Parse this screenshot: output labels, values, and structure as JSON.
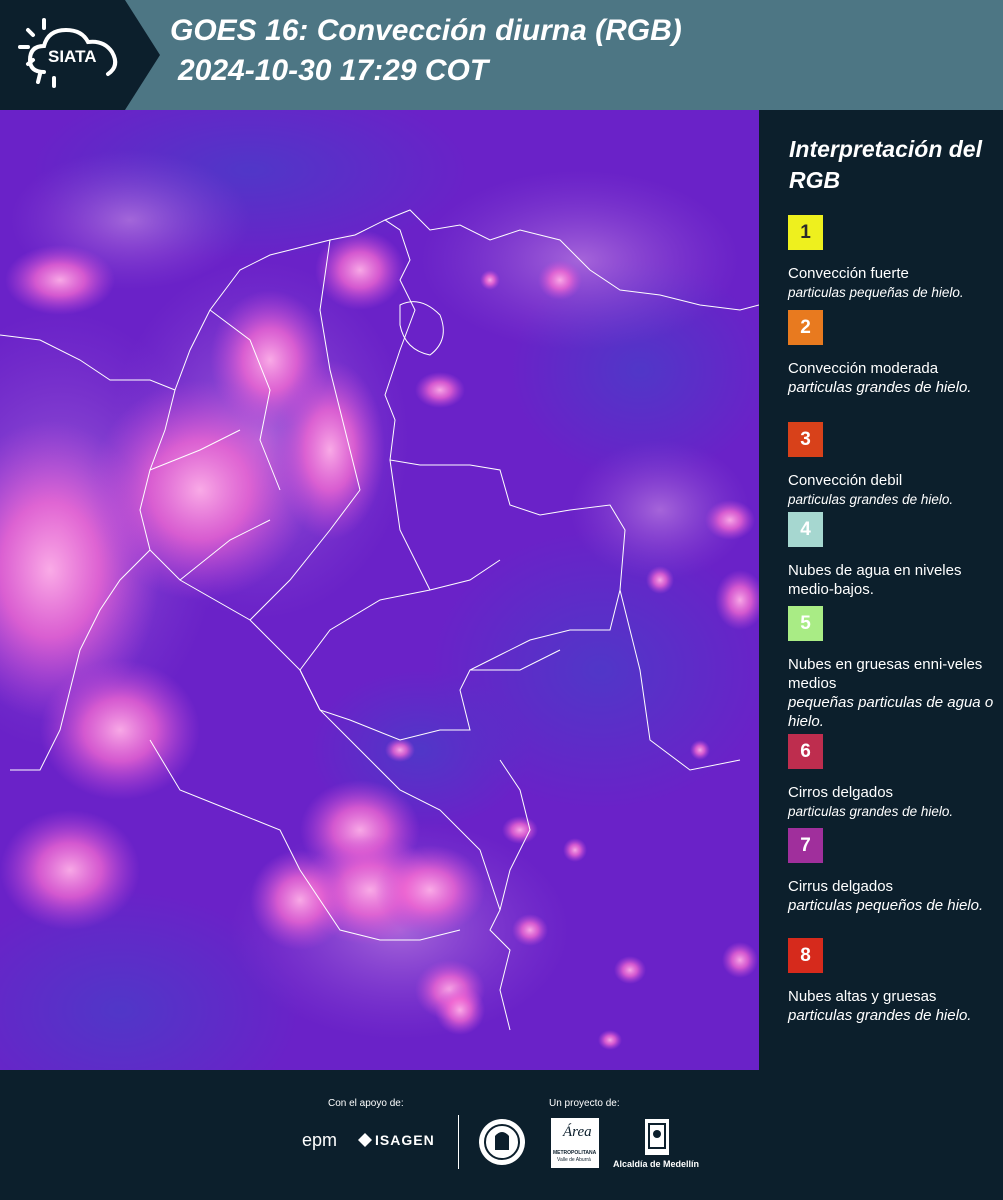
{
  "header": {
    "logo_text": "SIATA",
    "title_line1": "GOES 16: Convección diurna (RGB)",
    "title_line2": "2024-10-30 17:29 COT"
  },
  "legend": {
    "title": "Interpretación del RGB",
    "items": [
      {
        "number": "1",
        "color": "#eef01e",
        "name": "Convección fuerte",
        "description": "particulas pequeñas de hielo."
      },
      {
        "number": "2",
        "color": "#e87a1f",
        "name": "Convección moderada",
        "description": "particulas grandes de hielo."
      },
      {
        "number": "3",
        "color": "#d8411a",
        "name": "Convección debil",
        "description": "particulas grandes de hielo."
      },
      {
        "number": "4",
        "color": "#a6d7d0",
        "name": "Nubes de agua en niveles medio-bajos.",
        "description": ""
      },
      {
        "number": "5",
        "color": "#a9ec85",
        "name": "Nubes en gruesas enni-veles medios",
        "description": "pequeñas particulas de agua o hielo."
      },
      {
        "number": "6",
        "color": "#be2d4e",
        "name": "Cirros delgados",
        "description": "particulas grandes de hielo."
      },
      {
        "number": "7",
        "color": "#a02f9c",
        "name": "Cirrus delgados",
        "description": "particulas pequeños de hielo."
      },
      {
        "number": "8",
        "color": "#d62a1c",
        "name": "Nubes altas y gruesas",
        "description": "particulas grandes de hielo."
      }
    ]
  },
  "footer": {
    "support_label": "Con el apoyo de:",
    "project_label": "Un proyecto de:",
    "sponsors": [
      "epm",
      "ISAGEN"
    ],
    "metro_name": "Área",
    "metro_subtitle": "METROPOLITANA",
    "metro_subtitle2": "Valle de Aburrá",
    "alcaldia": "Alcaldía de Medellín"
  },
  "map": {
    "base_color": "#6a22c8",
    "cloud_color": "#ff5fc8",
    "border_color": "#ffffff"
  }
}
